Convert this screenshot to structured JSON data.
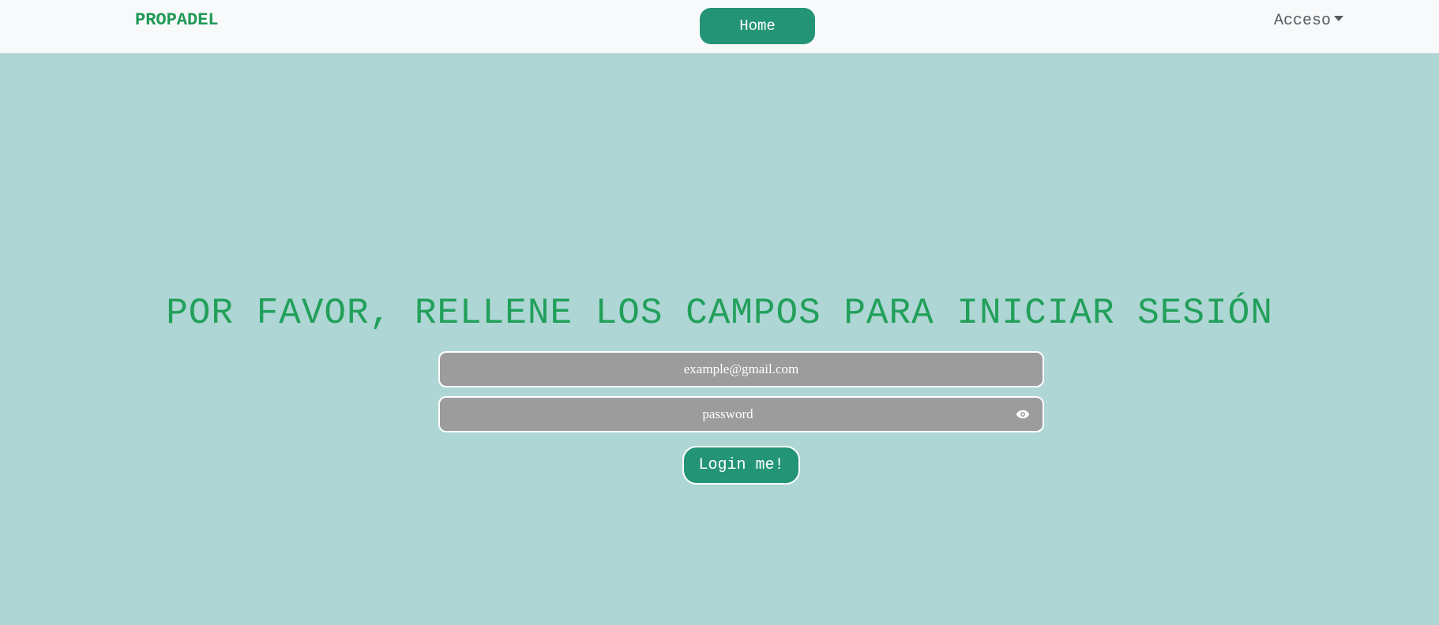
{
  "navbar": {
    "brand": "PROPADEL",
    "home_label": "Home",
    "access_label": "Acceso",
    "access_icon": "caret-down-icon"
  },
  "main": {
    "title": "POR FAVOR, RELLENE LOS CAMPOS PARA INICIAR SESIÓN",
    "email": {
      "placeholder": "example@gmail.com",
      "value": ""
    },
    "password": {
      "placeholder": "password",
      "value": "",
      "toggle_icon": "eye-icon"
    },
    "login_label": "Login me!"
  },
  "colors": {
    "background": "#aed6d5",
    "navbar": "#f8f9fa",
    "accent": "#239576",
    "title_green": "#22a05a",
    "input_bg": "#9c9c9c"
  }
}
